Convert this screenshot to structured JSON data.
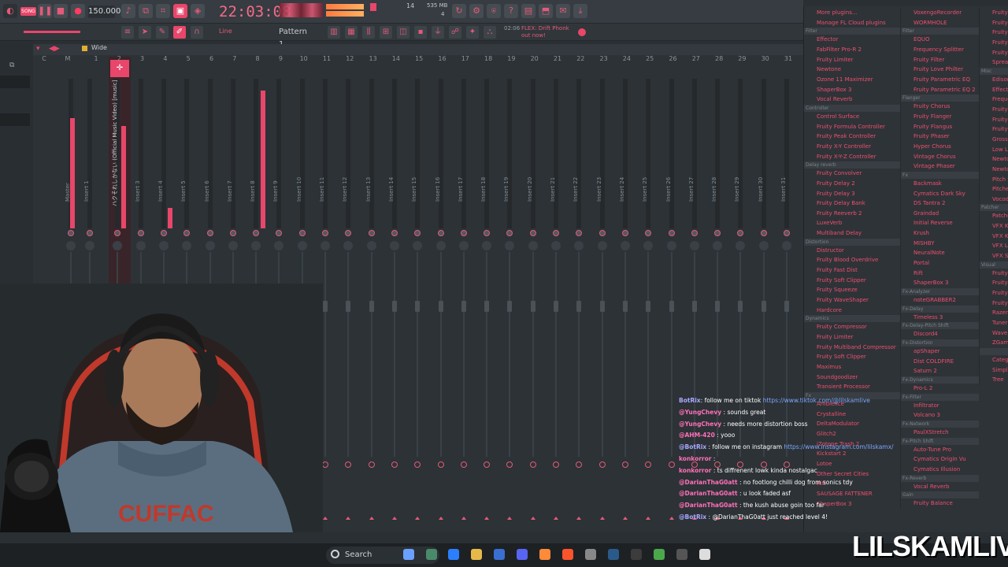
{
  "toolbar": {
    "tempo": "150.000",
    "clock": "22:03:08",
    "pattern": "Pattern 1",
    "snap": "Line",
    "song_hint_prefix": "02:06",
    "song_hint": "FLEX: Drift Phonk out now!",
    "cpu_top": "14",
    "mem_top": "535 MB",
    "mem_bottom": "4"
  },
  "mixer": {
    "wide_label": "Wide",
    "ruler_numbers": [
      "C",
      "M",
      "1",
      "2",
      "3",
      "4",
      "5",
      "6",
      "7",
      "8",
      "9",
      "10",
      "11",
      "12",
      "13",
      "14",
      "15",
      "16",
      "17",
      "18",
      "19",
      "20",
      "21",
      "22",
      "23",
      "24",
      "25",
      "26",
      "27",
      "28",
      "29",
      "30",
      "31"
    ],
    "tracks": [
      "Master",
      "Insert 1",
      "ハクそれしかない (Official Music Video) [music]",
      "Insert 3",
      "Insert 4",
      "Insert 5",
      "Insert 6",
      "Insert 7",
      "Insert 8",
      "Insert 9",
      "Insert 10",
      "Insert 11",
      "Insert 12",
      "Insert 13",
      "Insert 14",
      "Insert 15",
      "Insert 16",
      "Insert 17",
      "Insert 18",
      "Insert 19",
      "Insert 20",
      "Insert 21",
      "Insert 22",
      "Insert 23",
      "Insert 24",
      "Insert 25",
      "Insert 26",
      "Insert 27",
      "Insert 28",
      "Insert 29",
      "Insert 30",
      "Insert 31"
    ],
    "accent": "#e8466a"
  },
  "plugins": {
    "col1": [
      {
        "t": "top",
        "text": "More plugins..."
      },
      {
        "t": "top",
        "text": "Manage FL Cloud plugins"
      },
      {
        "t": "hdr",
        "text": "Filter"
      },
      {
        "t": "item",
        "text": "Effector"
      },
      {
        "t": "item",
        "text": "FabFilter Pro-R 2"
      },
      {
        "t": "item",
        "text": "Fruity Limiter"
      },
      {
        "t": "item",
        "text": "Newtone"
      },
      {
        "t": "item",
        "text": "Ozone 11 Maximizer"
      },
      {
        "t": "item",
        "text": "ShaperBox 3"
      },
      {
        "t": "item",
        "text": "Vocal Reverb"
      },
      {
        "t": "hdr",
        "text": "Controller"
      },
      {
        "t": "item",
        "text": "Control Surface"
      },
      {
        "t": "item",
        "text": "Fruity Formula Controller"
      },
      {
        "t": "item",
        "text": "Fruity Peak Controller"
      },
      {
        "t": "item",
        "text": "Fruity X-Y Controller"
      },
      {
        "t": "item",
        "text": "Fruity X-Y-Z Controller"
      },
      {
        "t": "hdr",
        "text": "Delay reverb"
      },
      {
        "t": "item",
        "text": "Fruity Convolver"
      },
      {
        "t": "item",
        "text": "Fruity Delay 2"
      },
      {
        "t": "item",
        "text": "Fruity Delay 3"
      },
      {
        "t": "item",
        "text": "Fruity Delay Bank"
      },
      {
        "t": "item",
        "text": "Fruity Reeverb 2"
      },
      {
        "t": "item",
        "text": "LuxeVerb"
      },
      {
        "t": "item",
        "text": "Multiband Delay"
      },
      {
        "t": "hdr",
        "text": "Distortion"
      },
      {
        "t": "item",
        "text": "Distructor"
      },
      {
        "t": "item",
        "text": "Fruity Blood Overdrive"
      },
      {
        "t": "item",
        "text": "Fruity Fast Dist"
      },
      {
        "t": "item",
        "text": "Fruity Soft Clipper"
      },
      {
        "t": "item",
        "text": "Fruity Squeeze"
      },
      {
        "t": "item",
        "text": "Fruity WaveShaper"
      },
      {
        "t": "item",
        "text": "Hardcore"
      },
      {
        "t": "hdr",
        "text": "Dynamics"
      },
      {
        "t": "item",
        "text": "Fruity Compressor"
      },
      {
        "t": "item",
        "text": "Fruity Limiter"
      },
      {
        "t": "item",
        "text": "Fruity Multiband Compressor"
      },
      {
        "t": "item",
        "text": "Fruity Soft Clipper"
      },
      {
        "t": "item",
        "text": "Maximus"
      },
      {
        "t": "item",
        "text": "Soundgoodizer"
      },
      {
        "t": "item",
        "text": "Transient Processor"
      },
      {
        "t": "hdr",
        "text": "Fx"
      },
      {
        "t": "item",
        "text": "Ambience"
      },
      {
        "t": "item",
        "text": "Crystalline"
      },
      {
        "t": "item",
        "text": "DeltaModulator"
      },
      {
        "t": "item",
        "text": "Glitch2"
      },
      {
        "t": "item",
        "text": "iZotope Trash 2"
      },
      {
        "t": "item",
        "text": "Kickstart 2"
      },
      {
        "t": "item",
        "text": "Lotoe"
      },
      {
        "t": "item",
        "text": "Other Secret Cities"
      },
      {
        "t": "item",
        "text": "Rift"
      },
      {
        "t": "item",
        "text": "SAUSAGE FATTENER"
      },
      {
        "t": "item",
        "text": "ShaperBox 3"
      }
    ],
    "col2": [
      {
        "t": "item",
        "text": "VoxengoRecorder"
      },
      {
        "t": "item",
        "text": "WORMHOLE"
      },
      {
        "t": "hdr",
        "text": "Filter"
      },
      {
        "t": "item",
        "text": "EQUO"
      },
      {
        "t": "item",
        "text": "Frequency Splitter"
      },
      {
        "t": "item",
        "text": "Fruity Filter"
      },
      {
        "t": "item",
        "text": "Fruity Love Philter"
      },
      {
        "t": "item",
        "text": "Fruity Parametric EQ"
      },
      {
        "t": "item",
        "text": "Fruity Parametric EQ 2"
      },
      {
        "t": "hdr",
        "text": "Flanger"
      },
      {
        "t": "item",
        "text": "Fruity Chorus"
      },
      {
        "t": "item",
        "text": "Fruity Flanger"
      },
      {
        "t": "item",
        "text": "Fruity Flangus"
      },
      {
        "t": "item",
        "text": "Fruity Phaser"
      },
      {
        "t": "item",
        "text": "Hyper Chorus"
      },
      {
        "t": "item",
        "text": "Vintage Chorus"
      },
      {
        "t": "item",
        "text": "Vintage Phaser"
      },
      {
        "t": "hdr",
        "text": "Fx"
      },
      {
        "t": "item",
        "text": "Backmask"
      },
      {
        "t": "item",
        "text": "Cymatics Dark Sky"
      },
      {
        "t": "item",
        "text": "DS Tantra 2"
      },
      {
        "t": "item",
        "text": "Graindad"
      },
      {
        "t": "item",
        "text": "Initial Reverse"
      },
      {
        "t": "item",
        "text": "Krush"
      },
      {
        "t": "item",
        "text": "MISHBY"
      },
      {
        "t": "item",
        "text": "NeuralNote"
      },
      {
        "t": "item",
        "text": "Portal"
      },
      {
        "t": "item",
        "text": "Rift"
      },
      {
        "t": "item",
        "text": "ShaperBox 3"
      },
      {
        "t": "hdr",
        "text": "Fx-Analyzer"
      },
      {
        "t": "item",
        "text": "noteGRABBER2"
      },
      {
        "t": "hdr",
        "text": "Fx-Delay"
      },
      {
        "t": "item",
        "text": "Timeless 3"
      },
      {
        "t": "hdr",
        "text": "Fx-Delay-Pitch Shift"
      },
      {
        "t": "item",
        "text": "Discord4"
      },
      {
        "t": "hdr",
        "text": "Fx-Distortion"
      },
      {
        "t": "item",
        "text": "apShaper"
      },
      {
        "t": "item",
        "text": "Dist COLDFIRE"
      },
      {
        "t": "item",
        "text": "Saturn 2"
      },
      {
        "t": "hdr",
        "text": "Fx-Dynamics"
      },
      {
        "t": "item",
        "text": "Pro-L 2"
      },
      {
        "t": "hdr",
        "text": "Fx-Filter"
      },
      {
        "t": "item",
        "text": "Infiltrator"
      },
      {
        "t": "item",
        "text": "Volcano 3"
      },
      {
        "t": "hdr",
        "text": "Fx-Network"
      },
      {
        "t": "item",
        "text": "PaulXStretch"
      },
      {
        "t": "hdr",
        "text": "Fx-Pitch Shift"
      },
      {
        "t": "item",
        "text": "Auto-Tune Pro"
      },
      {
        "t": "item",
        "text": "Cymatics Origin Vu"
      },
      {
        "t": "item",
        "text": "Cymatics Illusion"
      },
      {
        "t": "hdr",
        "text": "Fx-Reverb"
      },
      {
        "t": "item",
        "text": "Vocal Reverb"
      },
      {
        "t": "hdr",
        "text": "Gain"
      },
      {
        "t": "item",
        "text": "Fruity Balance"
      }
    ],
    "col3": [
      {
        "t": "item",
        "text": "Fruity"
      },
      {
        "t": "item",
        "text": "Fruity"
      },
      {
        "t": "item",
        "text": "Fruity"
      },
      {
        "t": "item",
        "text": "Fruity"
      },
      {
        "t": "item",
        "text": "Fruity"
      },
      {
        "t": "item",
        "text": "Spread"
      },
      {
        "t": "hdr",
        "text": "Misc"
      },
      {
        "t": "item",
        "text": "Edison"
      },
      {
        "t": "item",
        "text": "Effecto"
      },
      {
        "t": "item",
        "text": "Freque"
      },
      {
        "t": "item",
        "text": "Fruity"
      },
      {
        "t": "item",
        "text": "Fruity"
      },
      {
        "t": "item",
        "text": "Fruity"
      },
      {
        "t": "item",
        "text": "Grossb"
      },
      {
        "t": "item",
        "text": "Low Li"
      },
      {
        "t": "item",
        "text": "Newto"
      },
      {
        "t": "item",
        "text": "Newto"
      },
      {
        "t": "item",
        "text": "Pitch S"
      },
      {
        "t": "item",
        "text": "Pitche"
      },
      {
        "t": "item",
        "text": "Vocod"
      },
      {
        "t": "hdr",
        "text": "Patcher"
      },
      {
        "t": "item",
        "text": "Patche"
      },
      {
        "t": "item",
        "text": "VFX Ke"
      },
      {
        "t": "item",
        "text": "VFX Ke"
      },
      {
        "t": "item",
        "text": "VFX Le"
      },
      {
        "t": "item",
        "text": "VFX Se"
      },
      {
        "t": "hdr",
        "text": "Visual"
      },
      {
        "t": "item",
        "text": "Fruity"
      },
      {
        "t": "item",
        "text": "Fruity"
      },
      {
        "t": "item",
        "text": "Fruity"
      },
      {
        "t": "item",
        "text": "Fruity"
      },
      {
        "t": "item",
        "text": "Razer"
      },
      {
        "t": "item",
        "text": "Tuner"
      },
      {
        "t": "item",
        "text": "Wave"
      },
      {
        "t": "item",
        "text": "ZGam"
      },
      {
        "t": "hdr",
        "text": ""
      },
      {
        "t": "item",
        "text": "Catego"
      },
      {
        "t": "item",
        "text": "Simple"
      },
      {
        "t": "item",
        "text": "Tree"
      }
    ]
  },
  "chat": [
    {
      "user": "BotRix",
      "sep": ": ",
      "msg": "follow me on tiktok ",
      "link": "https://www.tiktok.com/@lilskamlive",
      "bot": true
    },
    {
      "user": "@YungChevy",
      "sep": " : ",
      "msg": "sounds great",
      "link": "",
      "bot": false
    },
    {
      "user": "@YungChevy",
      "sep": " : ",
      "msg": "needs more distortion boss",
      "link": "",
      "bot": false
    },
    {
      "user": "@AHM-420",
      "sep": " : ",
      "msg": "yooo",
      "link": "",
      "bot": false
    },
    {
      "user": "@BotRix",
      "sep": " : ",
      "msg": "follow me on instagram ",
      "link": "https://www.instagram.com/lilskamx/",
      "bot": true
    },
    {
      "user": "konkorror",
      "sep": " : ",
      "msg": "",
      "link": "",
      "bot": false
    },
    {
      "user": "konkorror",
      "sep": " : ",
      "msg": "ts diffrenent lowk kinda nostalgac",
      "link": "",
      "bot": false
    },
    {
      "user": "@DarianThaG0att",
      "sep": " : ",
      "msg": "no footlong chilli dog from sonics tdy",
      "link": "",
      "bot": false
    },
    {
      "user": "@DarianThaG0att",
      "sep": " : ",
      "msg": "u look faded asf",
      "link": "",
      "bot": false
    },
    {
      "user": "@DarianThaG0att",
      "sep": " : ",
      "msg": "the kush abuse goin too far",
      "link": "",
      "bot": false
    },
    {
      "user": "@BotRix",
      "sep": " : ",
      "msg": "@DarianThaG0att just reached level 4!",
      "link": "",
      "bot": true
    }
  ],
  "taskbar": {
    "search_label": "Search"
  },
  "overlay": {
    "streamer_name": "LILSKAMLIVE"
  }
}
